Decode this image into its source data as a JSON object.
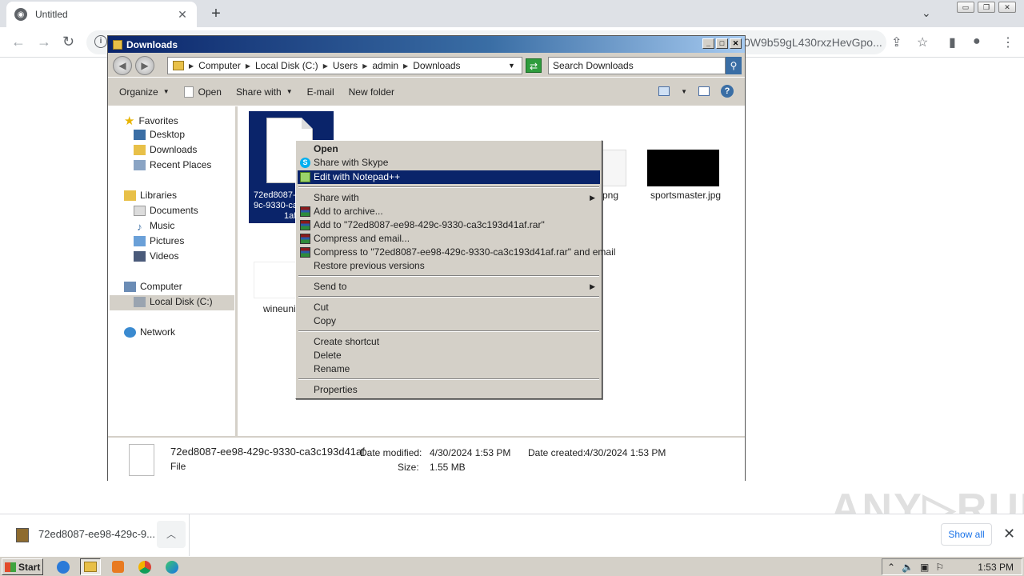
{
  "browser": {
    "tab_title": "Untitled",
    "tab_close": "✕",
    "new_tab": "+",
    "tab_chevron": "⌄",
    "url_tail": "0W9b59gL430rxzHevGpo...",
    "window_controls": [
      "▭",
      "❐",
      "✕"
    ]
  },
  "explorer": {
    "window_title": "Downloads",
    "title_controls": [
      "_",
      "□",
      "✕"
    ],
    "breadcrumb": [
      "Computer",
      "Local Disk (C:)",
      "Users",
      "admin",
      "Downloads"
    ],
    "search_placeholder": "Search Downloads",
    "commands": {
      "organize": "Organize",
      "open": "Open",
      "share_with": "Share with",
      "email": "E-mail",
      "new_folder": "New folder",
      "help": "?"
    },
    "nav": {
      "favorites": "Favorites",
      "desktop": "Desktop",
      "downloads": "Downloads",
      "recent_places": "Recent Places",
      "libraries": "Libraries",
      "documents": "Documents",
      "music": "Music",
      "pictures": "Pictures",
      "videos": "Videos",
      "computer": "Computer",
      "local_disk": "Local Disk (C:)",
      "network": "Network"
    },
    "files": {
      "selected_line1": "72ed8087-",
      "selected_line2": "9c-9330-ca",
      "selected_line3": "1af",
      "png_suffix": "png",
      "sportsmaster": "sportsmaster.jpg",
      "wineunit_partial": "wineunit"
    },
    "details": {
      "name": "72ed8087-ee98-429c-9330-ca3c193d41af",
      "type": "File",
      "modified_label": "Date modified:",
      "modified_value": "4/30/2024 1:53 PM",
      "size_label": "Size:",
      "size_value": "1.55 MB",
      "created_label": "Date created:",
      "created_value": "4/30/2024 1:53 PM"
    }
  },
  "context_menu": {
    "open": "Open",
    "share_skype": "Share with Skype",
    "edit_npp": "Edit with Notepad++",
    "share_with": "Share with",
    "add_archive": "Add to archive...",
    "add_rar": "Add to \"72ed8087-ee98-429c-9330-ca3c193d41af.rar\"",
    "compress_email": "Compress and email...",
    "compress_rar_email": "Compress to \"72ed8087-ee98-429c-9330-ca3c193d41af.rar\" and email",
    "restore": "Restore previous versions",
    "send_to": "Send to",
    "cut": "Cut",
    "copy": "Copy",
    "create_shortcut": "Create shortcut",
    "delete": "Delete",
    "rename": "Rename",
    "properties": "Properties",
    "submenu_arrow": "▶"
  },
  "download_shelf": {
    "filename": "72ed8087-ee98-429c-9...",
    "chevron": "︿",
    "show_all": "Show all",
    "close": "✕",
    "watermark": "ANY▷RUN"
  },
  "taskbar": {
    "start": "Start",
    "clock": "1:53 PM"
  }
}
